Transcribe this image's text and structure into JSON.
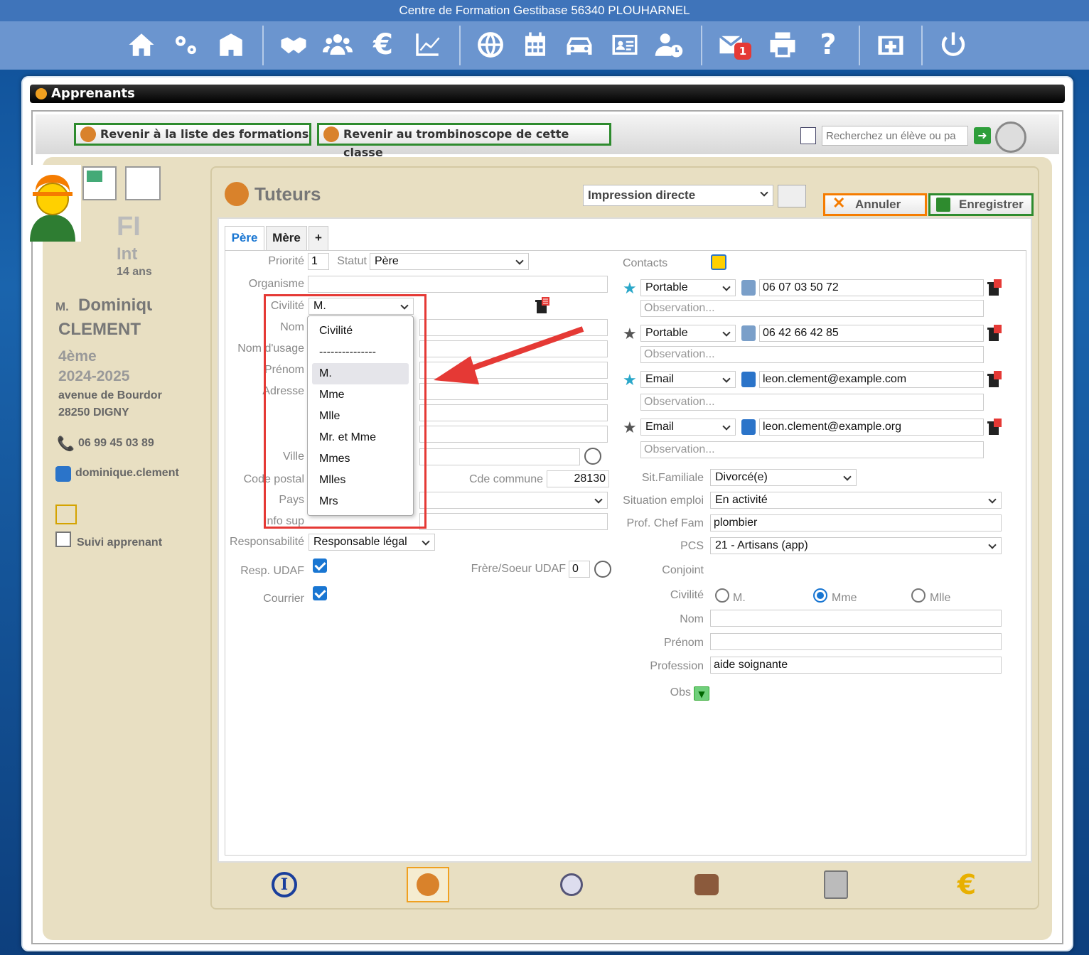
{
  "app_title": "Centre de Formation Gestibase 56340 PLOUHARNEL",
  "nav": {
    "icons": [
      "home-icon",
      "cogs-icon",
      "building-icon",
      "handshake-icon",
      "users-icon",
      "euro-icon",
      "chart-icon",
      "globe-icon",
      "calendar-icon",
      "car-icon",
      "id-card-icon",
      "user-clock-icon",
      "mail-icon",
      "print-icon",
      "help-icon",
      "medical-icon",
      "power-icon"
    ],
    "mail_badge": "1"
  },
  "window": {
    "title": "Apprenants"
  },
  "toolbar": {
    "back_formations": "Revenir à la liste des formations",
    "back_trombi": "Revenir au trombinoscope de cette classe",
    "search_placeholder": "Recherchez un élève ou pa"
  },
  "student": {
    "initials": "FI",
    "status": "Int",
    "age": "14 ans",
    "civility": "M.",
    "firstname": "Dominiqu",
    "lastname": "CLEMENT",
    "class": "4ème",
    "year": "2024-2025",
    "address": "avenue de Bourdor",
    "city": "28250 DIGNY",
    "phone": "06 99 45 03 89",
    "email": "dominique.clement",
    "followup": "Suivi apprenant"
  },
  "panel": {
    "title": "Tuteurs",
    "print_select": "Impression directe",
    "cancel": "Annuler",
    "save": "Enregistrer",
    "tabs": [
      "Père",
      "Mère",
      "+"
    ]
  },
  "form": {
    "priorite_label": "Priorité",
    "priorite": "1",
    "statut_label": "Statut",
    "statut": "Père",
    "organisme_label": "Organisme",
    "civilite_label": "Civilité",
    "civilite": "M.",
    "nom_label": "Nom",
    "nom_usage_label": "Nom d'usage",
    "prenom_label": "Prénom",
    "adresse_label": "Adresse",
    "ville_label": "Ville",
    "code_postal_label": "Code postal",
    "cde_commune_label": "Cde commune",
    "cde_commune": "28130",
    "pays_label": "Pays",
    "info_sup_label": "Info sup",
    "responsabilite_label": "Responsabilité",
    "responsabilite": "Responsable légal",
    "resp_udaf_label": "Resp. UDAF",
    "frere_soeur_label": "Frère/Soeur UDAF",
    "frere_soeur": "0",
    "courrier_label": "Courrier"
  },
  "civilite_options": [
    "Civilité",
    "---------------",
    "M.",
    "Mme",
    "Mlle",
    "Mr. et Mme",
    "Mmes",
    "Mlles",
    "Mrs"
  ],
  "contacts": {
    "label": "Contacts",
    "observation_placeholder": "Observation...",
    "items": [
      {
        "type": "Portable",
        "value": "06 07 03 50 72"
      },
      {
        "type": "Portable",
        "value": "06 42 66 42 85"
      },
      {
        "type": "Email",
        "value": "leon.clement@example.com"
      },
      {
        "type": "Email",
        "value": "leon.clement@example.org"
      }
    ]
  },
  "right": {
    "sit_fam_label": "Sit.Familiale",
    "sit_fam": "Divorcé(e)",
    "sit_emploi_label": "Situation emploi",
    "sit_emploi": "En activité",
    "prof_label": "Prof. Chef Fam",
    "prof": "plombier",
    "pcs_label": "PCS",
    "pcs": "21 - Artisans (app)",
    "conjoint_label": "Conjoint",
    "civ_label": "Civilité",
    "civ_options": [
      "M.",
      "Mme",
      "Mlle"
    ],
    "nom_label": "Nom",
    "prenom_label": "Prénom",
    "profession_label": "Profession",
    "profession": "aide soignante",
    "obs_label": "Obs"
  },
  "colors": {
    "accent": "#1976d2",
    "highlight": "#e53935",
    "nav": "#6b95cf",
    "beige": "#e8dfc2"
  }
}
